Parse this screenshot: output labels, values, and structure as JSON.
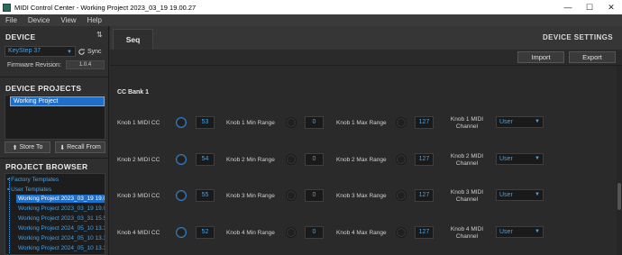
{
  "window": {
    "title": "MIDI Control Center - Working Project 2023_03_19 19.00.27",
    "minimize": "—",
    "maximize": "☐",
    "close": "✕"
  },
  "menu": [
    "File",
    "Device",
    "View",
    "Help"
  ],
  "sidebar": {
    "device_heading": "DEVICE",
    "device_arrows": "⇅",
    "device_select": "KeyStep 37",
    "sync_label": "Sync",
    "firmware_label": "Firmware Revision:",
    "firmware_value": "1.0.4",
    "projects_heading": "DEVICE PROJECTS",
    "project_item": "Working Project",
    "store_label": "Store To",
    "recall_label": "Recall From",
    "browser_heading": "PROJECT BROWSER",
    "tree": [
      {
        "label": "Factory Templates",
        "selected": false
      },
      {
        "label": "User Templates",
        "selected": false
      },
      {
        "label": "Working Project 2023_03_19 19.00.27",
        "selected": true
      },
      {
        "label": "Working Project 2023_03_19 19.01.26",
        "selected": false
      },
      {
        "label": "Working Project 2023_03_31 15.55.57",
        "selected": false
      },
      {
        "label": "Working Project 2024_05_10 13.30.26",
        "selected": false
      },
      {
        "label": "Working Project 2024_05_10 13.35.08",
        "selected": false
      },
      {
        "label": "Working Project 2024_05_10 13.36.02",
        "selected": false
      }
    ]
  },
  "main": {
    "tab_label": "Seq",
    "device_settings": "DEVICE SETTINGS",
    "import_label": "Import",
    "export_label": "Export",
    "cc_bank": "CC Bank 1",
    "rows": [
      {
        "cc_label": "Knob 1 MIDI CC",
        "cc": "53",
        "min_label": "Knob 1 Min Range",
        "min": "0",
        "max_label": "Knob 1 Max Range",
        "max": "127",
        "channel_label": "Knob 1 MIDI Channel",
        "channel": "User"
      },
      {
        "cc_label": "Knob 2 MIDI CC",
        "cc": "54",
        "min_label": "Knob 2 Min Range",
        "min": "0",
        "max_label": "Knob 2 Max Range",
        "max": "127",
        "channel_label": "Knob 2 MIDI Channel",
        "channel": "User"
      },
      {
        "cc_label": "Knob 3 MIDI CC",
        "cc": "55",
        "min_label": "Knob 3 Min Range",
        "min": "0",
        "max_label": "Knob 3 Max Range",
        "max": "127",
        "channel_label": "Knob 3 MIDI Channel",
        "channel": "User"
      },
      {
        "cc_label": "Knob 4 MIDI CC",
        "cc": "52",
        "min_label": "Knob 4 Min Range",
        "min": "0",
        "max_label": "Knob 4 Max Range",
        "max": "127",
        "channel_label": "Knob 4 MIDI Channel",
        "channel": "User"
      }
    ]
  },
  "colors": {
    "accent": "#4aa0e0",
    "selection": "#1f6fc8",
    "background": "#2a2a2a"
  }
}
